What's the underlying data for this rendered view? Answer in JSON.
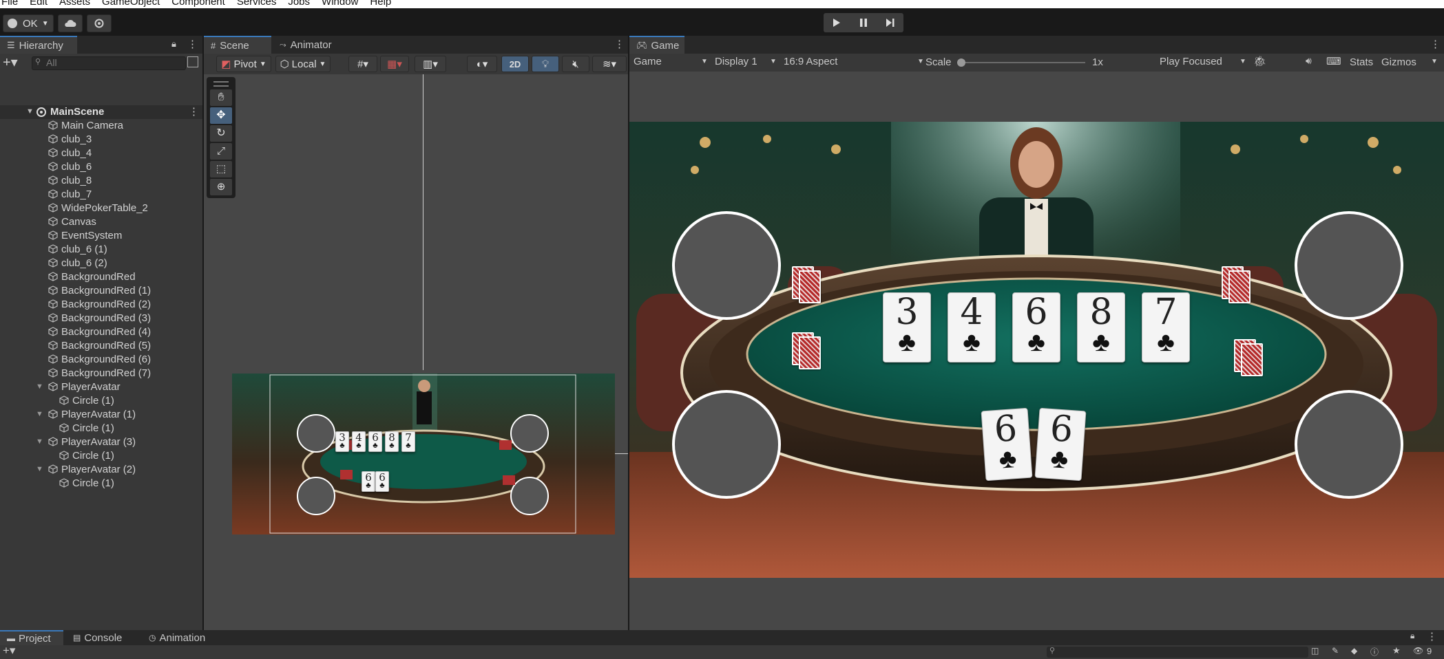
{
  "menu": [
    "File",
    "Edit",
    "Assets",
    "GameObject",
    "Component",
    "Services",
    "Jobs",
    "Window",
    "Help"
  ],
  "toolbar": {
    "account_label": "OK"
  },
  "hierarchy": {
    "tab": "Hierarchy",
    "search_placeholder": "All",
    "scene": "MainScene",
    "items": [
      {
        "label": "Main Camera",
        "indent": 1,
        "arrow": false
      },
      {
        "label": "club_3",
        "indent": 1,
        "arrow": false
      },
      {
        "label": "club_4",
        "indent": 1,
        "arrow": false
      },
      {
        "label": "club_6",
        "indent": 1,
        "arrow": false
      },
      {
        "label": "club_8",
        "indent": 1,
        "arrow": false
      },
      {
        "label": "club_7",
        "indent": 1,
        "arrow": false
      },
      {
        "label": "WidePokerTable_2",
        "indent": 1,
        "arrow": false
      },
      {
        "label": "Canvas",
        "indent": 1,
        "arrow": false
      },
      {
        "label": "EventSystem",
        "indent": 1,
        "arrow": false
      },
      {
        "label": "club_6 (1)",
        "indent": 1,
        "arrow": false
      },
      {
        "label": "club_6 (2)",
        "indent": 1,
        "arrow": false
      },
      {
        "label": "BackgroundRed",
        "indent": 1,
        "arrow": false
      },
      {
        "label": "BackgroundRed (1)",
        "indent": 1,
        "arrow": false
      },
      {
        "label": "BackgroundRed (2)",
        "indent": 1,
        "arrow": false
      },
      {
        "label": "BackgroundRed (3)",
        "indent": 1,
        "arrow": false
      },
      {
        "label": "BackgroundRed (4)",
        "indent": 1,
        "arrow": false
      },
      {
        "label": "BackgroundRed (5)",
        "indent": 1,
        "arrow": false
      },
      {
        "label": "BackgroundRed (6)",
        "indent": 1,
        "arrow": false
      },
      {
        "label": "BackgroundRed (7)",
        "indent": 1,
        "arrow": false
      },
      {
        "label": "PlayerAvatar",
        "indent": 1,
        "arrow": true
      },
      {
        "label": "Circle (1)",
        "indent": 2,
        "arrow": false
      },
      {
        "label": "PlayerAvatar (1)",
        "indent": 1,
        "arrow": true
      },
      {
        "label": "Circle (1)",
        "indent": 2,
        "arrow": false
      },
      {
        "label": "PlayerAvatar (3)",
        "indent": 1,
        "arrow": true
      },
      {
        "label": "Circle (1)",
        "indent": 2,
        "arrow": false
      },
      {
        "label": "PlayerAvatar (2)",
        "indent": 1,
        "arrow": true
      },
      {
        "label": "Circle (1)",
        "indent": 2,
        "arrow": false
      }
    ]
  },
  "scene_view": {
    "tabs": [
      "Scene",
      "Animator"
    ],
    "pivot": "Pivot",
    "local": "Local",
    "mode_2d": "2D"
  },
  "game_view": {
    "tab": "Game",
    "game_dropdown": "Game",
    "display": "Display 1",
    "aspect": "16:9 Aspect",
    "scale_label": "Scale",
    "scale_value": "1x",
    "play_mode": "Play Focused",
    "stats": "Stats",
    "gizmos": "Gizmos",
    "community_cards": [
      "3",
      "4",
      "6",
      "8",
      "7"
    ],
    "hand_cards": [
      "6",
      "6"
    ]
  },
  "bottom": {
    "tabs": [
      "Project",
      "Console",
      "Animation"
    ],
    "count": "9"
  },
  "colors": {
    "accent": "#3a79bb",
    "felt": "#0e5a48",
    "panel": "#383838",
    "table_rim": "#3a2a1e"
  }
}
